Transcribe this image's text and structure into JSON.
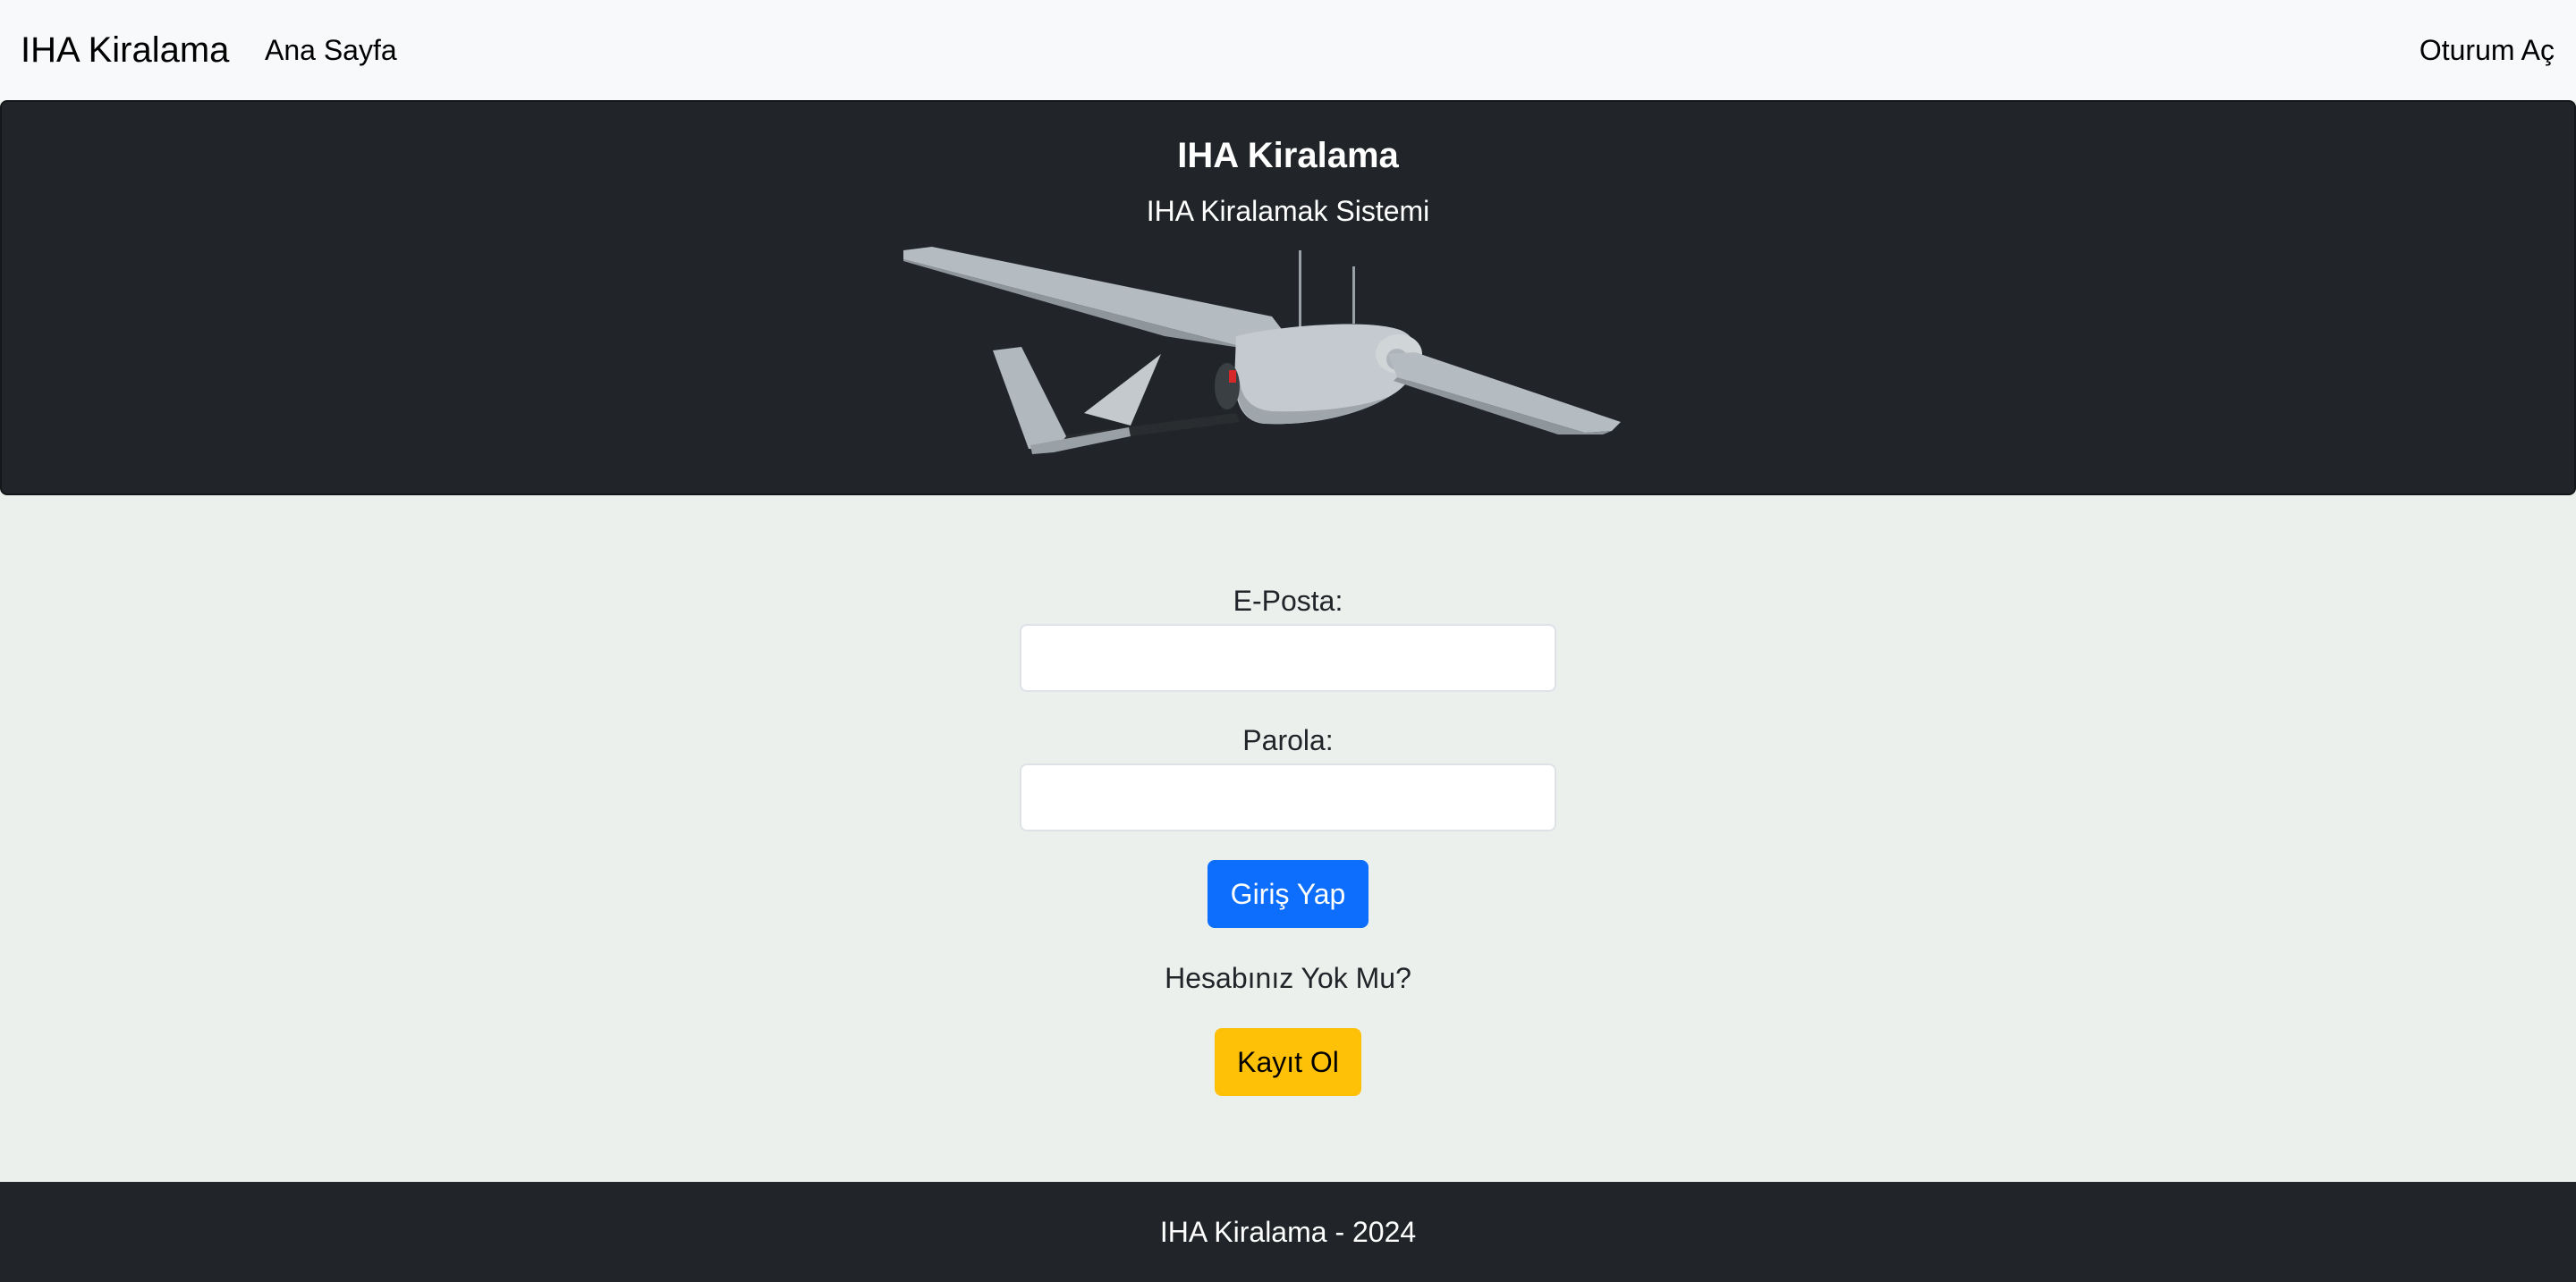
{
  "navbar": {
    "brand": "IHA Kiralama",
    "home_link": "Ana Sayfa",
    "login_link": "Oturum Aç"
  },
  "hero": {
    "title": "IHA Kiralama",
    "subtitle": "IHA Kiralamak Sistemi",
    "image_icon": "drone-image"
  },
  "form": {
    "email_label": "E-Posta:",
    "email_value": "",
    "password_label": "Parola:",
    "password_value": "",
    "submit_label": "Giriş Yap",
    "no_account_text": "Hesabınız Yok Mu?",
    "register_label": "Kayıt Ol"
  },
  "footer": {
    "text": "IHA Kiralama - 2024"
  },
  "colors": {
    "navbar_bg": "#f8f9fa",
    "hero_bg": "#212529",
    "page_bg": "#ecf0ec",
    "primary": "#0d6efd",
    "warning": "#ffc107",
    "footer_bg": "#212529"
  }
}
